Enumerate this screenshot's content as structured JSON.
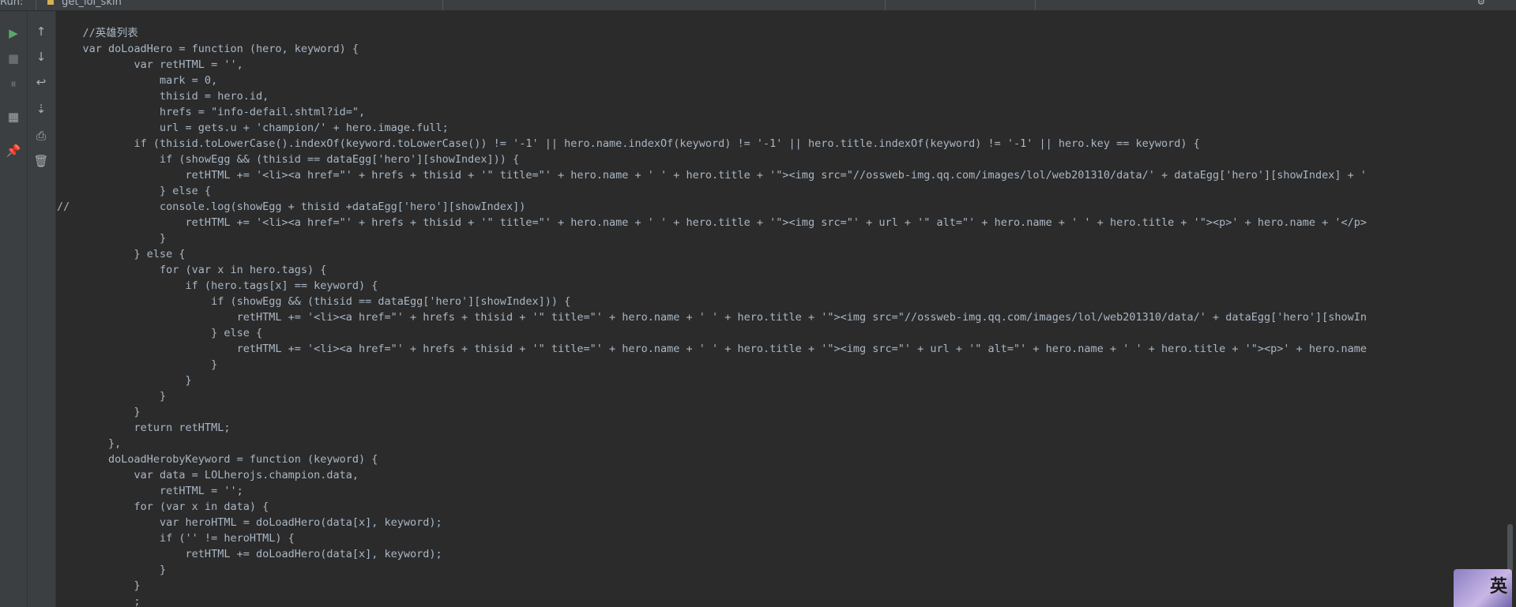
{
  "tabs": {
    "run_label": "Run:",
    "file_label": "get_lol_skin"
  },
  "toolbar": {
    "left": [
      {
        "name": "run-icon",
        "glyph": "▶",
        "color": "#59a869"
      },
      {
        "name": "stop-icon",
        "glyph": "■",
        "color": "#6b6b6b"
      },
      {
        "name": "pause-icon",
        "glyph": "⏸",
        "color": "#6b6b6b"
      },
      {
        "name": "layout-icon",
        "glyph": "▦",
        "color": "#a9a9a9"
      },
      {
        "name": "pin-icon",
        "glyph": "📌",
        "color": "#a9a9a9"
      }
    ],
    "right": [
      {
        "name": "arrow-up-icon",
        "glyph": "↑"
      },
      {
        "name": "arrow-down-icon",
        "glyph": "↓"
      },
      {
        "name": "soft-wrap-icon",
        "glyph": "↩"
      },
      {
        "name": "scroll-to-end-icon",
        "glyph": "⇣"
      },
      {
        "name": "print-icon",
        "glyph": "⎙"
      },
      {
        "name": "trash-icon",
        "glyph": "🗑"
      }
    ]
  },
  "code_lines": [
    "    //英雄列表",
    "    var doLoadHero = function (hero, keyword) {",
    "            var retHTML = '',",
    "                mark = 0,",
    "                thisid = hero.id,",
    "                hrefs = \"info-defail.shtml?id=\",",
    "                url = gets.u + 'champion/' + hero.image.full;",
    "            if (thisid.toLowerCase().indexOf(keyword.toLowerCase()) != '-1' || hero.name.indexOf(keyword) != '-1' || hero.title.indexOf(keyword) != '-1' || hero.key == keyword) {",
    "                if (showEgg && (thisid == dataEgg['hero'][showIndex])) {",
    "                    retHTML += '<li><a href=\"' + hrefs + thisid + '\" title=\"' + hero.name + ' ' + hero.title + '\"><img src=\"//ossweb-img.qq.com/images/lol/web201310/data/' + dataEgg['hero'][showIndex] + '",
    "                } else {",
    "//              console.log(showEgg + thisid +dataEgg['hero'][showIndex])",
    "                    retHTML += '<li><a href=\"' + hrefs + thisid + '\" title=\"' + hero.name + ' ' + hero.title + '\"><img src=\"' + url + '\" alt=\"' + hero.name + ' ' + hero.title + '\"><p>' + hero.name + '</p>",
    "                }",
    "            } else {",
    "                for (var x in hero.tags) {",
    "                    if (hero.tags[x] == keyword) {",
    "                        if (showEgg && (thisid == dataEgg['hero'][showIndex])) {",
    "                            retHTML += '<li><a href=\"' + hrefs + thisid + '\" title=\"' + hero.name + ' ' + hero.title + '\"><img src=\"//ossweb-img.qq.com/images/lol/web201310/data/' + dataEgg['hero'][showIn",
    "                        } else {",
    "                            retHTML += '<li><a href=\"' + hrefs + thisid + '\" title=\"' + hero.name + ' ' + hero.title + '\"><img src=\"' + url + '\" alt=\"' + hero.name + ' ' + hero.title + '\"><p>' + hero.name",
    "                        }",
    "                    }",
    "                }",
    "            }",
    "            return retHTML;",
    "        },",
    "        doLoadHerobyKeyword = function (keyword) {",
    "            var data = LOLherojs.champion.data,",
    "                retHTML = '';",
    "            for (var x in data) {",
    "                var heroHTML = doLoadHero(data[x], keyword);",
    "                if ('' != heroHTML) {",
    "                    retHTML += doLoadHero(data[x], keyword);",
    "                }",
    "            }",
    "            ;"
  ],
  "avatar": {
    "glyph": "英"
  }
}
